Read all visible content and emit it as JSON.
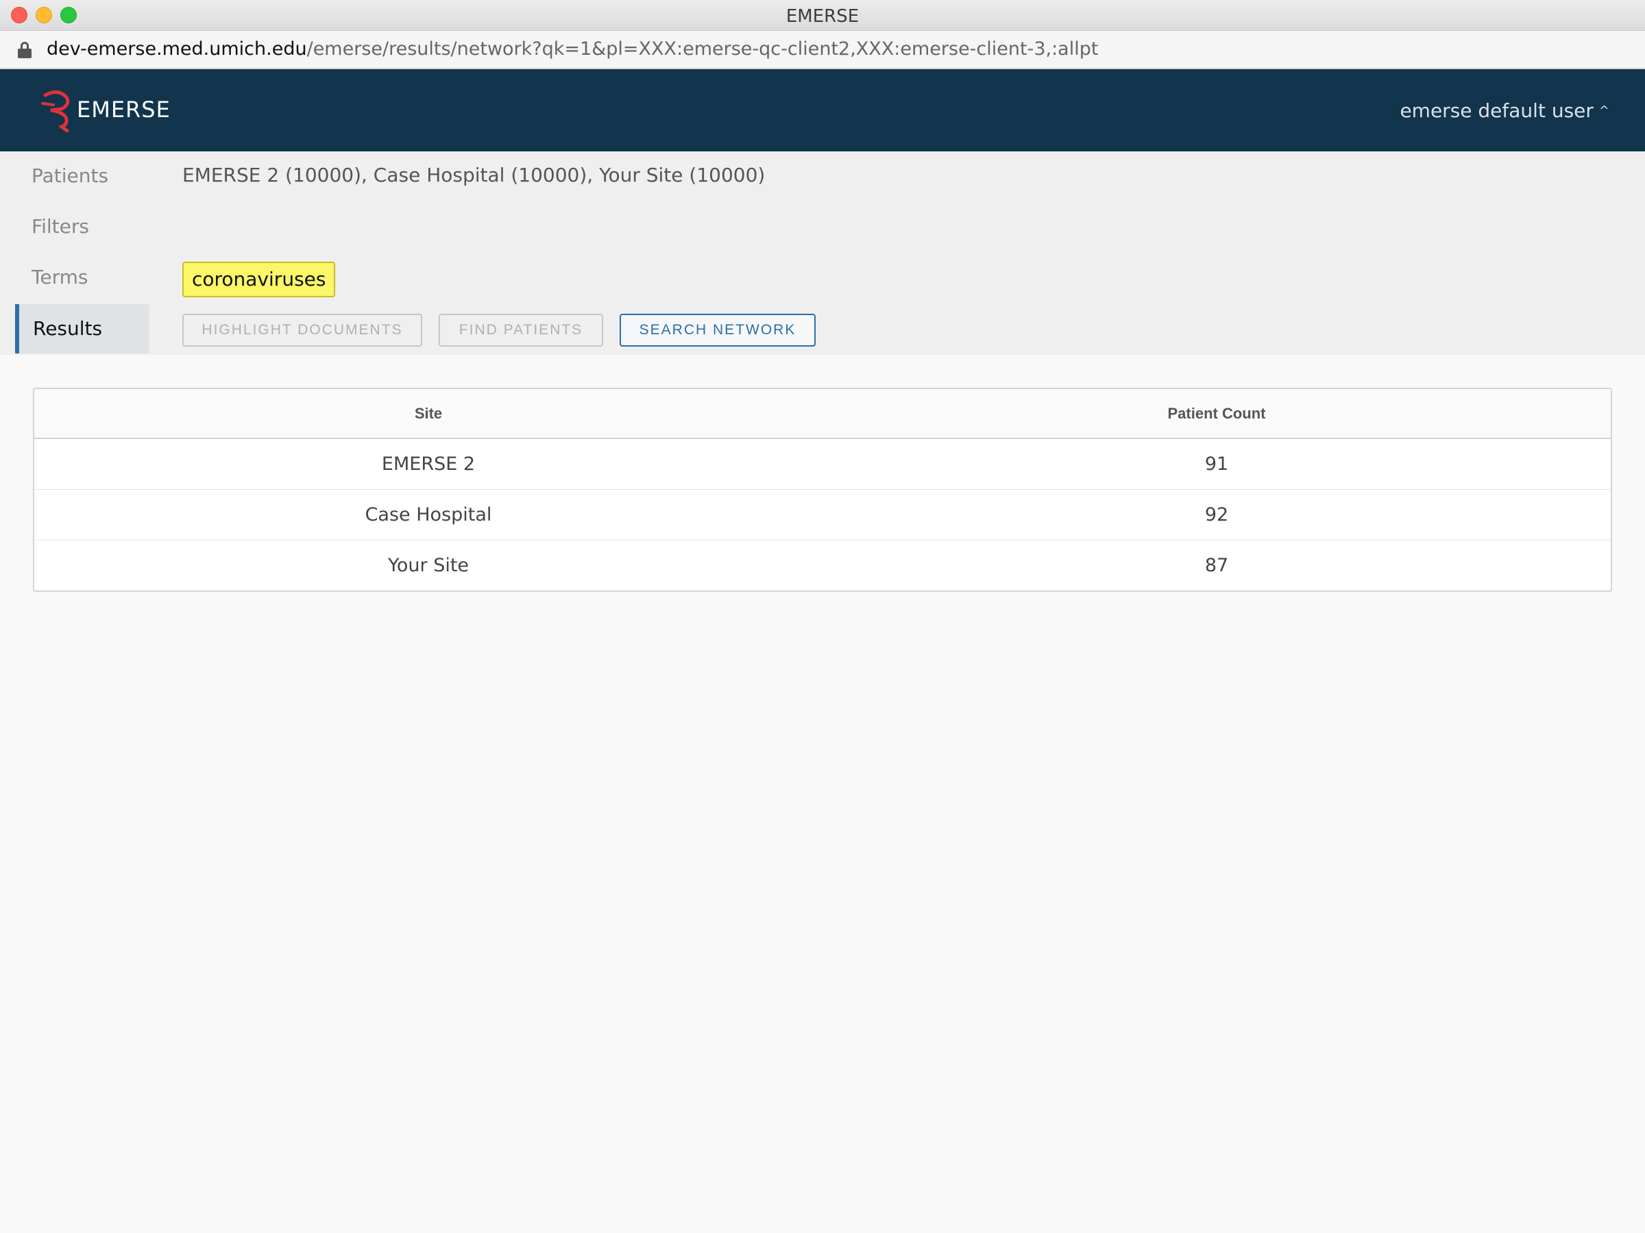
{
  "window": {
    "title": "EMERSE",
    "url_host": "dev-emerse.med.umich.edu",
    "url_path": "/emerse/results/network?qk=1&pl=XXX:emerse-qc-client2,XXX:emerse-client-3,:allpt"
  },
  "header": {
    "logo_text": "EMERSE",
    "user_label": "emerse default user",
    "brand_color": "#12344d",
    "logo_color": "#e0323c"
  },
  "nav": {
    "items": [
      {
        "label": "Patients"
      },
      {
        "label": "Filters"
      },
      {
        "label": "Terms"
      },
      {
        "label": "Results"
      }
    ],
    "active": "Results"
  },
  "query": {
    "patients_summary": "EMERSE 2 (10000), Case Hospital (10000), Your Site (10000)",
    "terms": [
      "coronaviruses"
    ]
  },
  "actions": {
    "highlight_documents": "HIGHLIGHT DOCUMENTS",
    "find_patients": "FIND PATIENTS",
    "search_network": "SEARCH NETWORK"
  },
  "results_table": {
    "headers": [
      "Site",
      "Patient Count"
    ],
    "rows": [
      {
        "site": "EMERSE 2",
        "count": "91"
      },
      {
        "site": "Case Hospital",
        "count": "92"
      },
      {
        "site": "Your Site",
        "count": "87"
      }
    ]
  }
}
